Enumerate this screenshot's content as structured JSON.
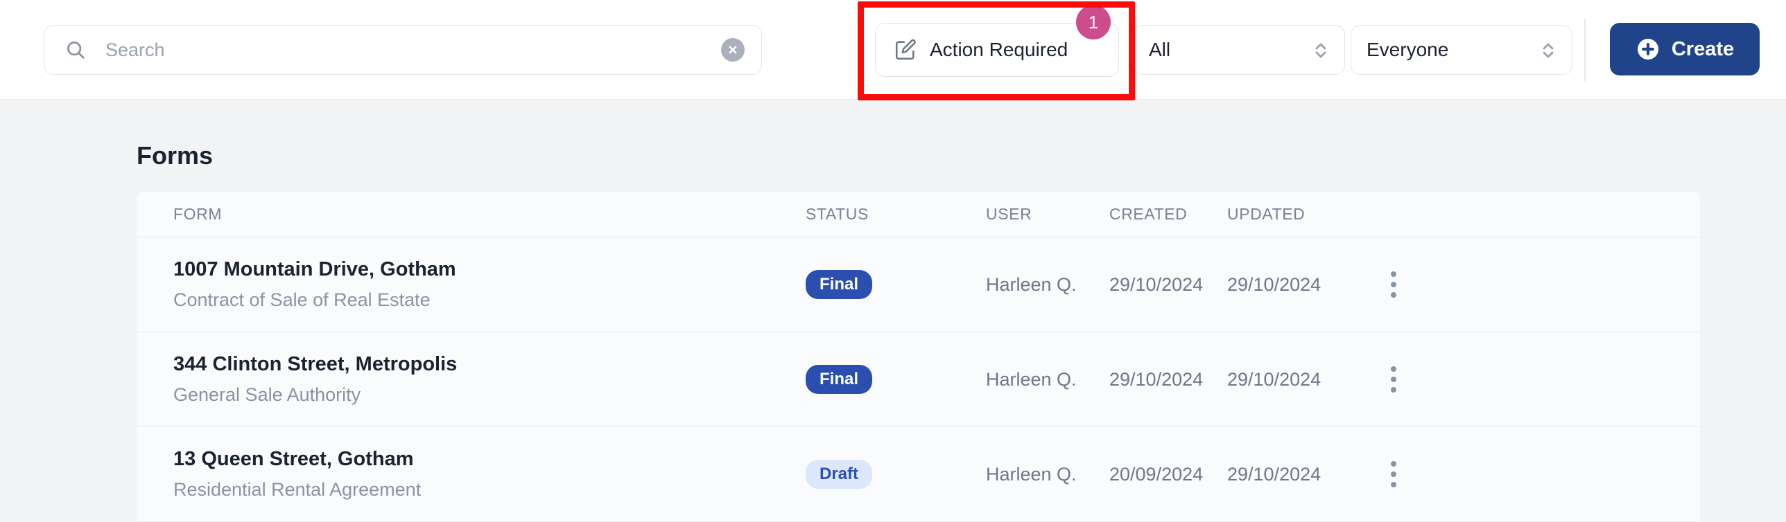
{
  "toolbar": {
    "search": {
      "placeholder": "Search",
      "value": "",
      "icon": "search-icon",
      "clear_icon": "clear-circle-icon"
    },
    "action_required": {
      "label": "Action Required",
      "icon": "pencil-square-icon",
      "badge_count": "1",
      "badge_color": "#cc4c8c",
      "highlighted": true,
      "highlight_color": "#fb0c0c"
    },
    "status_filter": {
      "value": "All",
      "icon": "chevron-updown-icon"
    },
    "user_filter": {
      "value": "Everyone",
      "icon": "chevron-updown-icon"
    },
    "create": {
      "label": "Create",
      "icon": "plus-circle-icon",
      "color": "#1f4489"
    }
  },
  "main": {
    "section_title": "Forms",
    "table": {
      "columns": [
        "FORM",
        "STATUS",
        "USER",
        "CREATED",
        "UPDATED"
      ],
      "rows": [
        {
          "title": "1007 Mountain Drive, Gotham",
          "subtitle": "Contract of Sale of Real Estate",
          "status": "Final",
          "status_style": "final",
          "user": "Harleen Q.",
          "created": "29/10/2024",
          "updated": "29/10/2024",
          "menu_icon": "kebab-menu-icon"
        },
        {
          "title": "344 Clinton Street, Metropolis",
          "subtitle": "General Sale Authority",
          "status": "Final",
          "status_style": "final",
          "user": "Harleen Q.",
          "created": "29/10/2024",
          "updated": "29/10/2024",
          "menu_icon": "kebab-menu-icon"
        },
        {
          "title": "13 Queen Street, Gotham",
          "subtitle": "Residential Rental Agreement",
          "status": "Draft",
          "status_style": "draft",
          "user": "Harleen Q.",
          "created": "20/09/2024",
          "updated": "29/10/2024",
          "menu_icon": "kebab-menu-icon"
        }
      ]
    }
  }
}
